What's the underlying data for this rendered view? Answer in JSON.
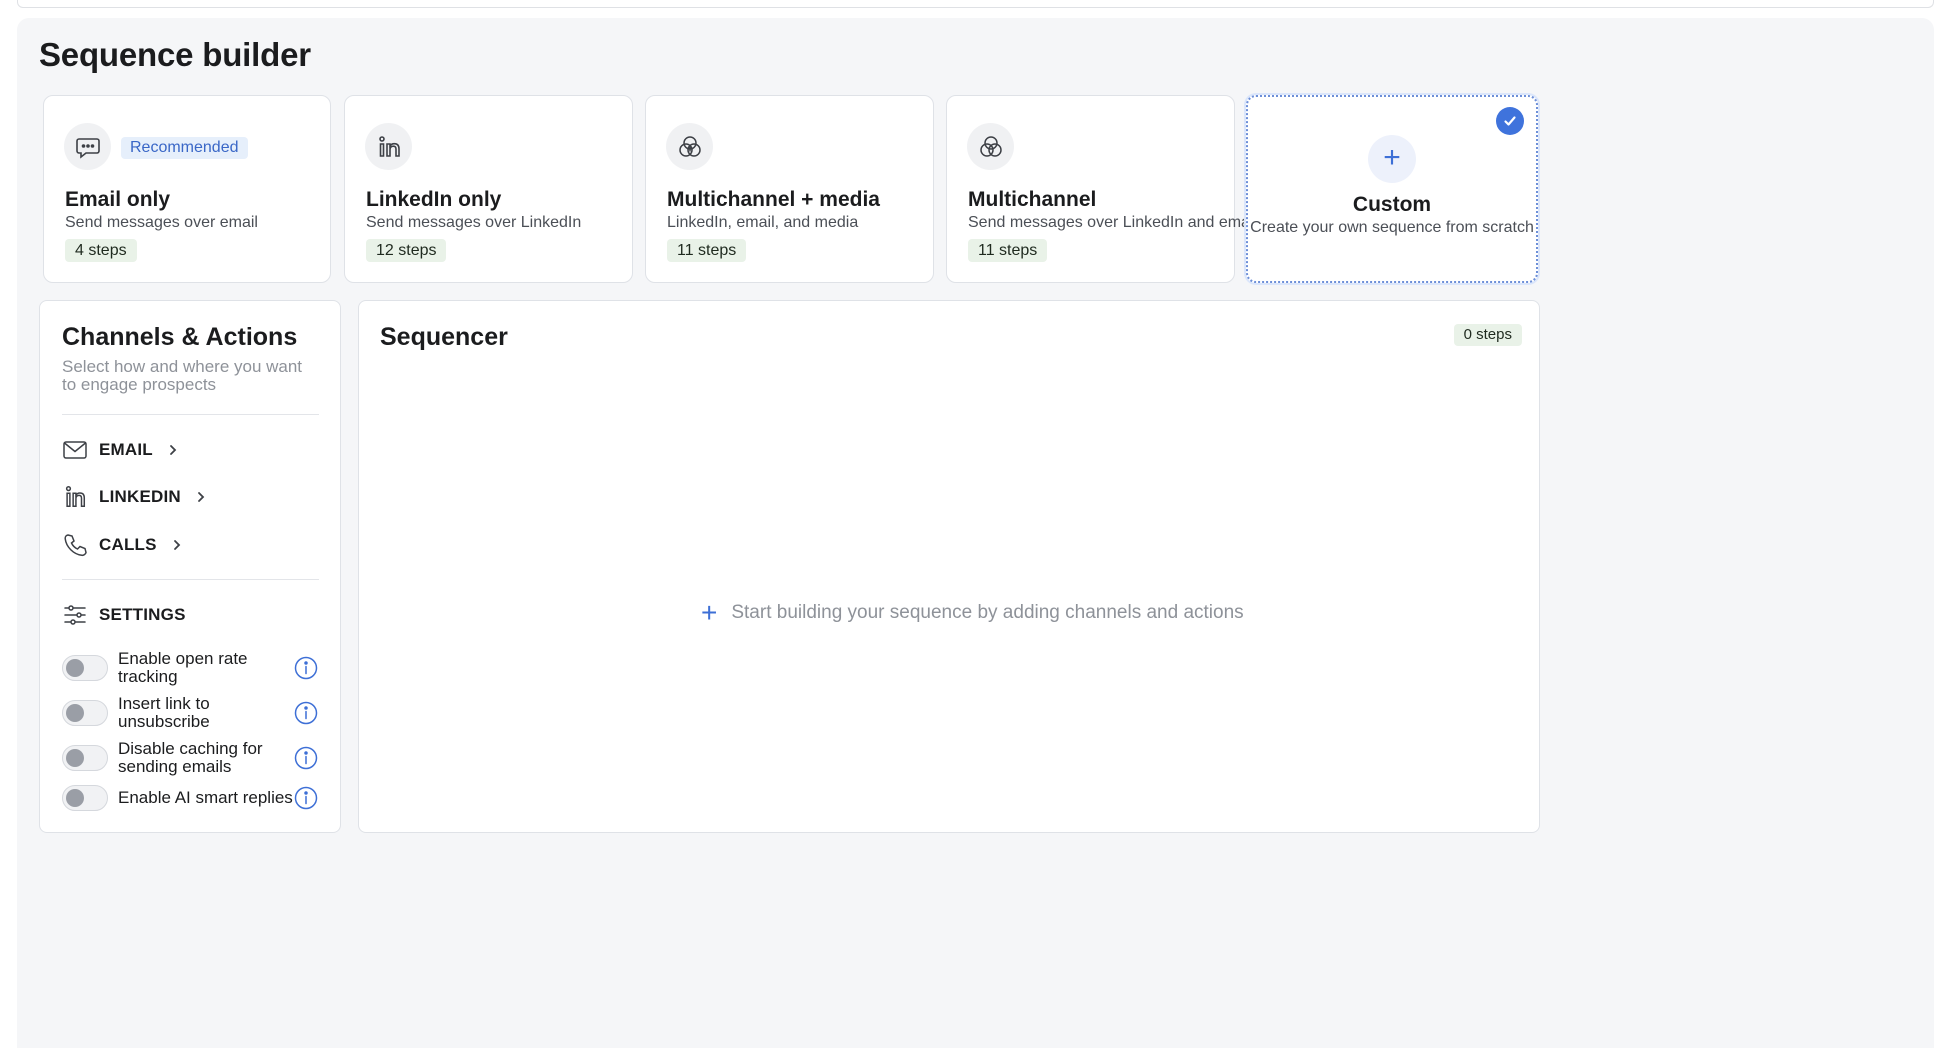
{
  "page": {
    "title": "Sequence builder"
  },
  "templates": [
    {
      "title": "Email only",
      "description": "Send messages over email",
      "steps": "4 steps",
      "badge": "Recommended",
      "icon": "chat-bubble-icon"
    },
    {
      "title": "LinkedIn only",
      "description": "Send messages over LinkedIn",
      "steps": "12 steps",
      "icon": "linkedin-icon"
    },
    {
      "title": "Multichannel + media",
      "description": "LinkedIn, email, and media",
      "steps": "11 steps",
      "icon": "multichannel-media-icon"
    },
    {
      "title": "Multichannel",
      "description": "Send messages over LinkedIn and email",
      "steps": "11 steps",
      "icon": "multichannel-icon"
    },
    {
      "title": "Custom",
      "description": "Create your own sequence from scratch",
      "selected": true,
      "icon": "plus-icon"
    }
  ],
  "channels": {
    "title": "Channels & Actions",
    "subtitle": "Select how and where you want to engage prospects",
    "items": [
      {
        "label": "EMAIL",
        "icon": "mail-icon"
      },
      {
        "label": "LINKEDIN",
        "icon": "linkedin-icon"
      },
      {
        "label": "CALLS",
        "icon": "phone-icon"
      }
    ],
    "settings_label": "SETTINGS",
    "settings": [
      {
        "label": "Enable open rate tracking",
        "enabled": false
      },
      {
        "label": "Insert link to unsubscribe",
        "enabled": false
      },
      {
        "label": "Disable caching for sending emails",
        "enabled": false
      },
      {
        "label": "Enable AI smart replies",
        "enabled": false
      }
    ]
  },
  "sequencer": {
    "title": "Sequencer",
    "steps": "0 steps",
    "empty_text": "Start building your sequence by adding channels and actions"
  },
  "colors": {
    "accent": "#3f73dc",
    "steps_badge_bg": "#e9f2e8",
    "panel_bg": "#f5f6f8"
  }
}
